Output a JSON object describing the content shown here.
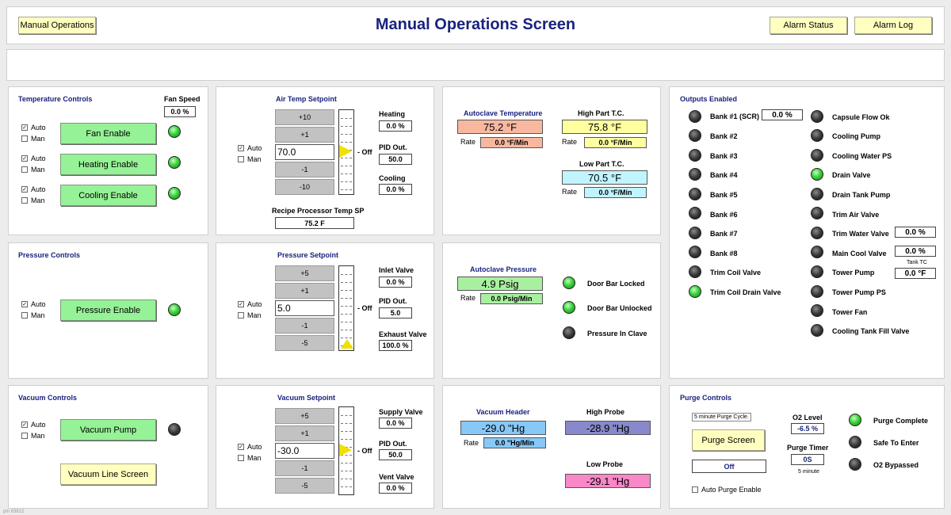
{
  "header": {
    "title": "Manual Operations Screen",
    "manual_ops_btn": "Manual Operations",
    "alarm_status_btn": "Alarm Status",
    "alarm_log_btn": "Alarm Log"
  },
  "temp_controls": {
    "title": "Temperature Controls",
    "fan_speed_label": "Fan Speed",
    "fan_speed_value": "0.0 %",
    "auto": "Auto",
    "man": "Man",
    "fan_enable": "Fan Enable",
    "heating_enable": "Heating Enable",
    "cooling_enable": "Cooling Enable"
  },
  "air_setpoint": {
    "title": "Air Temp Setpoint",
    "plus10": "+10",
    "plus1": "+1",
    "minus1": "-1",
    "minus10": "-10",
    "value": "70.0",
    "off": "- Off",
    "auto": "Auto",
    "man": "Man",
    "heating_label": "Heating",
    "heating_value": "0.0 %",
    "pid_label": "PID Out.",
    "pid_value": "50.0",
    "cooling_label": "Cooling",
    "cooling_value": "0.0 %",
    "recipe_label": "Recipe Processor Temp SP",
    "recipe_value": "75.2 F"
  },
  "autoclave_temp": {
    "title": "Autoclave Temperature",
    "value": "75.2 °F",
    "rate_label": "Rate",
    "rate_value": "0.0 °F/Min",
    "high_title": "High Part T.C.",
    "high_value": "75.8 °F",
    "high_rate": "0.0 °F/Min",
    "low_title": "Low Part T.C.",
    "low_value": "70.5 °F",
    "low_rate": "0.0 °F/Min"
  },
  "outputs": {
    "title": "Outputs Enabled",
    "bank1_value": "0.0 %",
    "trim_water_value": "0.0 %",
    "main_cool_value": "0.0 %",
    "tank_tc_label": "Tank TC",
    "tank_tc_value": "0.0 °F",
    "left": [
      "Bank #1 (SCR)",
      "Bank #2",
      "Bank #3",
      "Bank #4",
      "Bank #5",
      "Bank #6",
      "Bank #7",
      "Bank #8",
      "Trim Coil Valve",
      "Trim Coil Drain Valve"
    ],
    "right": [
      "Capsule Flow Ok",
      "Cooling Pump",
      "Cooling Water PS",
      "Drain Valve",
      "Drain Tank Pump",
      "Trim Air Valve",
      "Trim Water Valve",
      "Main Cool Valve",
      "Tower Pump",
      "Tower Pump PS",
      "Tower Fan",
      "Cooling Tank Fill Valve"
    ]
  },
  "pressure_controls": {
    "title": "Pressure Controls",
    "auto": "Auto",
    "man": "Man",
    "pressure_enable": "Pressure Enable"
  },
  "pressure_setpoint": {
    "title": "Pressure Setpoint",
    "plus5": "+5",
    "plus1": "+1",
    "minus1": "-1",
    "minus5": "-5",
    "value": "5.0",
    "off": "- Off",
    "auto": "Auto",
    "man": "Man",
    "inlet_label": "Inlet Valve",
    "inlet_value": "0.0 %",
    "pid_label": "PID Out.",
    "pid_value": "5.0",
    "exhaust_label": "Exhaust Valve",
    "exhaust_value": "100.0 %"
  },
  "autoclave_pressure": {
    "title": "Autoclave Pressure",
    "value": "4.9 Psig",
    "rate_label": "Rate",
    "rate_value": "0.0 Psig/Min",
    "door_locked": "Door Bar Locked",
    "door_unlocked": "Door Bar Unlocked",
    "pressure_in_clave": "Pressure In Clave"
  },
  "vacuum_controls": {
    "title": "Vacuum Controls",
    "auto": "Auto",
    "man": "Man",
    "vacuum_pump": "Vacuum Pump",
    "vacuum_line": "Vacuum Line Screen"
  },
  "vacuum_setpoint": {
    "title": "Vacuum Setpoint",
    "plus5": "+5",
    "plus1": "+1",
    "minus1": "-1",
    "minus5": "-5",
    "value": "-30.0",
    "off": "- Off",
    "auto": "Auto",
    "man": "Man",
    "supply_label": "Supply Valve",
    "supply_value": "0.0 %",
    "pid_label": "PID Out.",
    "pid_value": "50.0",
    "vent_label": "Vent Valve",
    "vent_value": "0.0 %"
  },
  "vacuum_header": {
    "title": "Vacuum Header",
    "value": "-29.0 \"Hg",
    "rate_label": "Rate",
    "rate_value": "0.0 \"Hg/Min",
    "high_title": "High Probe",
    "high_value": "-28.9 \"Hg",
    "low_title": "Low Probe",
    "low_value": "-29.1 \"Hg"
  },
  "purge": {
    "title": "Purge Controls",
    "cycle_text": "5 minute Purge Cycle.",
    "purge_screen": "Purge Screen",
    "off_value": "Off",
    "auto_purge": "Auto Purge Enable",
    "o2_label": "O2 Level",
    "o2_value": "-6.5 %",
    "timer_label": "Purge Timer",
    "timer_value": "0S",
    "timer_sub": "5 minute",
    "purge_complete": "Purge Complete",
    "safe_to_enter": "Safe To Enter",
    "o2_bypassed": "O2 Bypassed"
  },
  "footer": {
    "id": "pln 83612"
  },
  "colors": {
    "title_blue": "#1a237e",
    "led_green": "#3ad23a",
    "button_green": "#96f296",
    "button_yellow": "#ffffc0"
  }
}
